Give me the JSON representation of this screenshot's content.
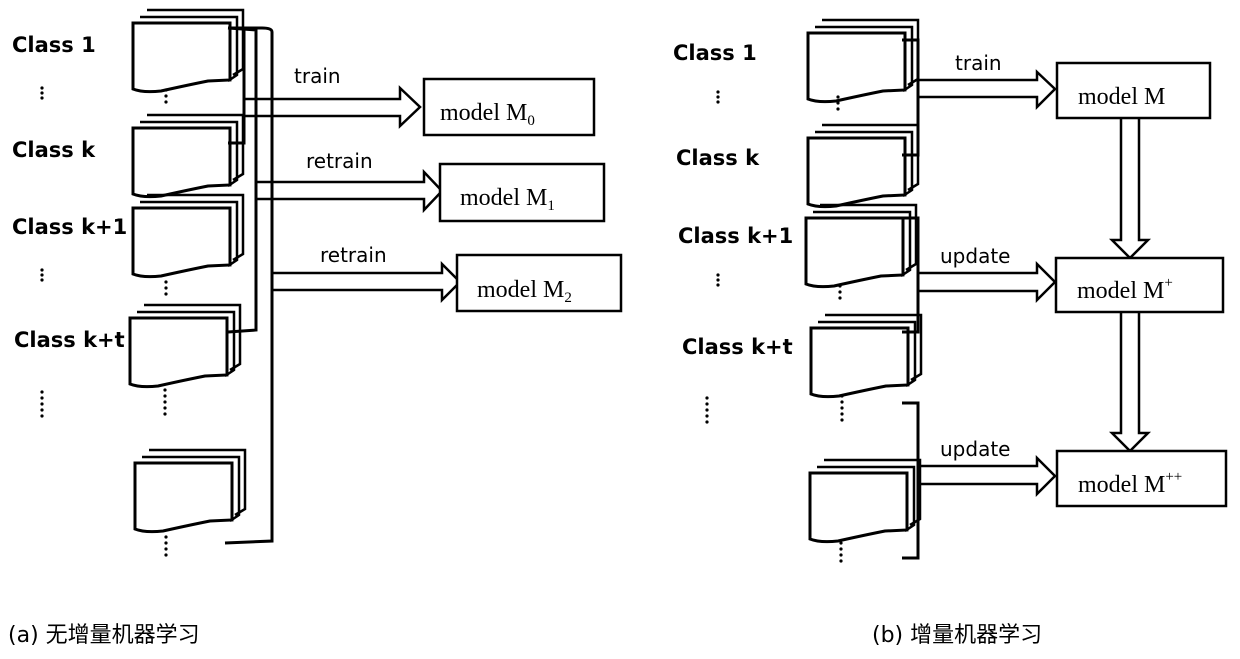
{
  "panel_a": {
    "caption": "(a) 无增量机器学习",
    "classes": [
      "Class 1",
      "Class k",
      "Class k+1",
      "Class k+t"
    ],
    "arrows": [
      "train",
      "retrain",
      "retrain"
    ],
    "models": [
      {
        "name": "model M",
        "sub": "0"
      },
      {
        "name": "model M",
        "sub": "1"
      },
      {
        "name": "model M",
        "sub": "2"
      }
    ]
  },
  "panel_b": {
    "caption": "(b) 增量机器学习",
    "classes": [
      "Class 1",
      "Class k",
      "Class k+1",
      "Class k+t"
    ],
    "arrows": [
      "train",
      "update",
      "update"
    ],
    "models": [
      {
        "name": "model M",
        "sup": ""
      },
      {
        "name": "model M",
        "sup": "+"
      },
      {
        "name": "model M",
        "sup": "++"
      }
    ]
  }
}
